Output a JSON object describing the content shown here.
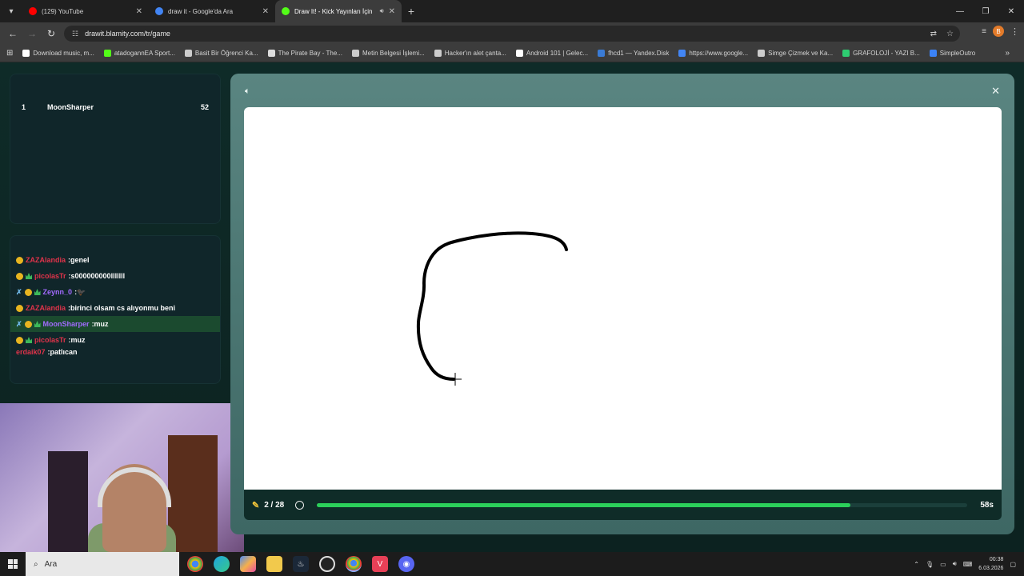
{
  "browser": {
    "tabs": [
      {
        "title": "(129) YouTube",
        "color": "#ff0000",
        "active": false
      },
      {
        "title": "draw it - Google'da Ara",
        "color": "#4285f4",
        "active": false
      },
      {
        "title": "Draw It! - Kick Yayınları İçin",
        "color": "#53fc18",
        "active": true
      }
    ],
    "new_tab": "+",
    "url": "drawit.blamity.com/tr/game",
    "profile_initial": "B",
    "bookmarks": [
      {
        "label": "Download music, m...",
        "color": "#ffffff"
      },
      {
        "label": "atadogannEA Sport...",
        "color": "#53fc18"
      },
      {
        "label": "Basit Bir Öğrenci Ka...",
        "color": "#cccccc"
      },
      {
        "label": "The Pirate Bay - The...",
        "color": "#dddddd"
      },
      {
        "label": "Metin Belgesi İşlemi...",
        "color": "#cccccc"
      },
      {
        "label": "Hacker'ın alet çanta...",
        "color": "#cccccc"
      },
      {
        "label": "Android 101 | Gelec...",
        "color": "#ffffff"
      },
      {
        "label": "fhcd1 — Yandex.Disk",
        "color": "#3a7bd5"
      },
      {
        "label": "https://www.google...",
        "color": "#4285f4"
      },
      {
        "label": "Simge Çizmek ve Ka...",
        "color": "#cccccc"
      },
      {
        "label": "GRAFOLOJİ - YAZI B...",
        "color": "#2ecc71"
      },
      {
        "label": "SimpleOutro",
        "color": "#3b82f6"
      }
    ]
  },
  "leaderboard": [
    {
      "rank": "1",
      "name": "MoonSharper",
      "score": "52"
    }
  ],
  "chat": [
    {
      "sword": false,
      "crown": false,
      "user": "ZAZAlandia",
      "user_color": "#e0334a",
      "text": ":genel",
      "highlight": false
    },
    {
      "sword": false,
      "crown": true,
      "user": "picolasTr",
      "user_color": "#e0334a",
      "text": ":s000000000lllllll",
      "highlight": false
    },
    {
      "sword": true,
      "crown": true,
      "user": "Zeynn_0",
      "user_color": "#a26bff",
      "text": ":🐦‍⬛",
      "highlight": false
    },
    {
      "sword": false,
      "crown": false,
      "user": "ZAZAlandia",
      "user_color": "#e0334a",
      "text": ":birinci olsam cs alıyonmu beni",
      "highlight": false
    },
    {
      "sword": true,
      "crown": true,
      "user": "MoonSharper",
      "user_color": "#a26bff",
      "text": ":muz",
      "highlight": true
    },
    {
      "sword": false,
      "crown": true,
      "user": "picolasTr",
      "user_color": "#e0334a",
      "text": ":muz",
      "highlight": false
    },
    {
      "sword": false,
      "crown": false,
      "user": "erdaik07",
      "user_color": "#e0334a",
      "text": ":patlıcan",
      "highlight": false,
      "cut": true
    }
  ],
  "game": {
    "round": "2 / 28",
    "time_left": "58s",
    "progress": 0.82
  },
  "taskbar": {
    "search_placeholder": "Ara",
    "time": "00:38",
    "date": "6.03.2026"
  },
  "colors": {
    "accent_green": "#2bd05a",
    "modal_teal": "#4f7b77"
  }
}
